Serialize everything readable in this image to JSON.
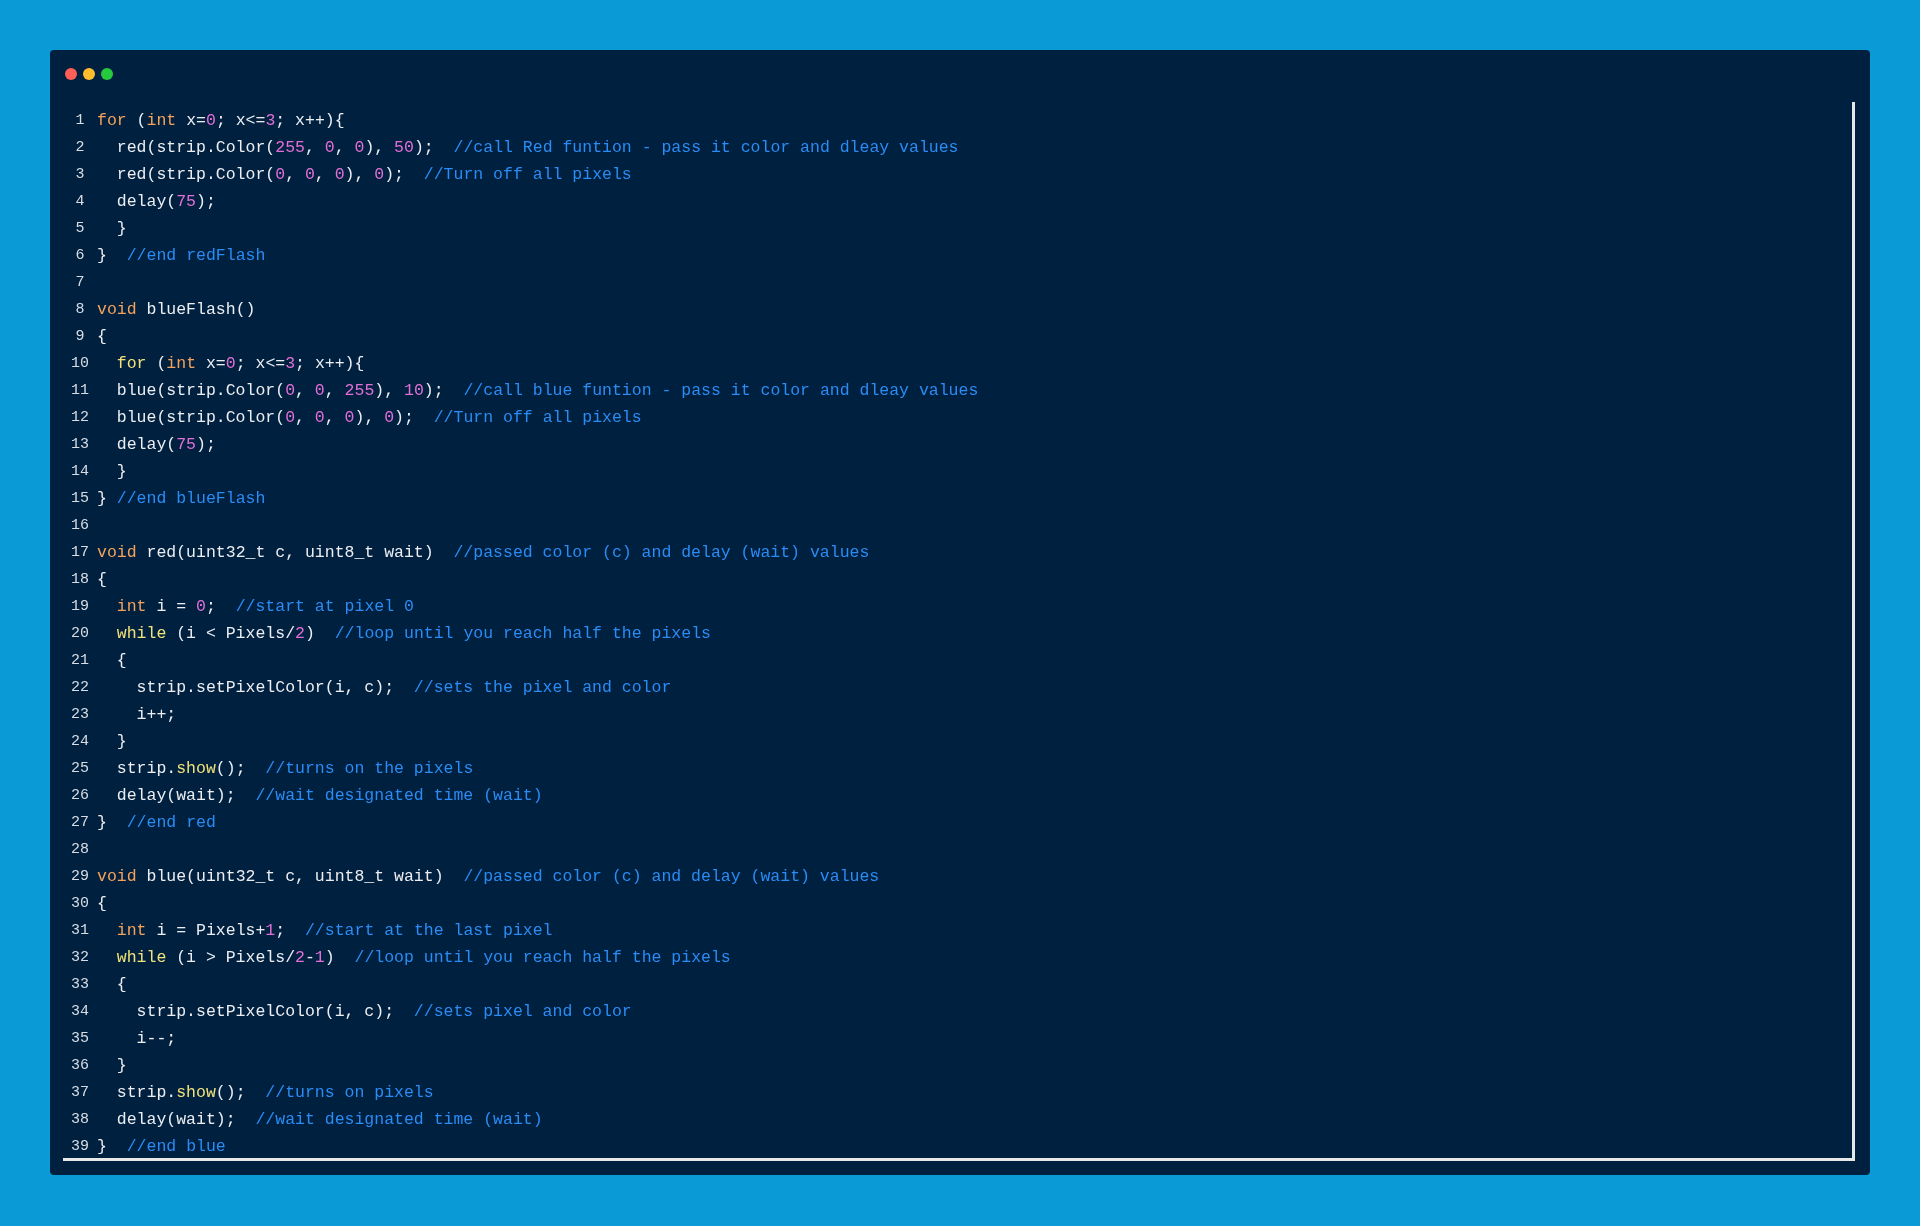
{
  "editor": {
    "lines": [
      {
        "number": "1",
        "tokens": [
          {
            "kind": "kw",
            "text": "for"
          },
          {
            "kind": "txt",
            "text": " ("
          },
          {
            "kind": "kw",
            "text": "int"
          },
          {
            "kind": "txt",
            "text": " x="
          },
          {
            "kind": "num",
            "text": "0"
          },
          {
            "kind": "txt",
            "text": "; x<="
          },
          {
            "kind": "num",
            "text": "3"
          },
          {
            "kind": "txt",
            "text": "; x++){"
          }
        ]
      },
      {
        "number": "2",
        "tokens": [
          {
            "kind": "txt",
            "text": "  red(strip.Color("
          },
          {
            "kind": "num",
            "text": "255"
          },
          {
            "kind": "txt",
            "text": ", "
          },
          {
            "kind": "num",
            "text": "0"
          },
          {
            "kind": "txt",
            "text": ", "
          },
          {
            "kind": "num",
            "text": "0"
          },
          {
            "kind": "txt",
            "text": "), "
          },
          {
            "kind": "num",
            "text": "50"
          },
          {
            "kind": "txt",
            "text": ");  "
          },
          {
            "kind": "cmt",
            "text": "//call Red funtion - pass it color and dleay values"
          }
        ]
      },
      {
        "number": "3",
        "tokens": [
          {
            "kind": "txt",
            "text": "  red(strip.Color("
          },
          {
            "kind": "num",
            "text": "0"
          },
          {
            "kind": "txt",
            "text": ", "
          },
          {
            "kind": "num",
            "text": "0"
          },
          {
            "kind": "txt",
            "text": ", "
          },
          {
            "kind": "num",
            "text": "0"
          },
          {
            "kind": "txt",
            "text": "), "
          },
          {
            "kind": "num",
            "text": "0"
          },
          {
            "kind": "txt",
            "text": ");  "
          },
          {
            "kind": "cmt",
            "text": "//Turn off all pixels"
          }
        ]
      },
      {
        "number": "4",
        "tokens": [
          {
            "kind": "txt",
            "text": "  delay("
          },
          {
            "kind": "num",
            "text": "75"
          },
          {
            "kind": "txt",
            "text": ");"
          }
        ]
      },
      {
        "number": "5",
        "tokens": [
          {
            "kind": "txt",
            "text": "  }"
          }
        ]
      },
      {
        "number": "6",
        "tokens": [
          {
            "kind": "txt",
            "text": "}  "
          },
          {
            "kind": "cmt",
            "text": "//end redFlash"
          }
        ]
      },
      {
        "number": "7"
      },
      {
        "number": "8",
        "tokens": [
          {
            "kind": "kw",
            "text": "void"
          },
          {
            "kind": "txt",
            "text": " blueFlash()"
          }
        ]
      },
      {
        "number": "9",
        "tokens": [
          {
            "kind": "txt",
            "text": "{"
          }
        ]
      },
      {
        "number": "10",
        "tokens": [
          {
            "kind": "ctl",
            "text": "  for"
          },
          {
            "kind": "txt",
            "text": " ("
          },
          {
            "kind": "kw",
            "text": "int"
          },
          {
            "kind": "txt",
            "text": " x="
          },
          {
            "kind": "num",
            "text": "0"
          },
          {
            "kind": "txt",
            "text": "; x<="
          },
          {
            "kind": "num",
            "text": "3"
          },
          {
            "kind": "txt",
            "text": "; x++){"
          }
        ]
      },
      {
        "number": "11",
        "tokens": [
          {
            "kind": "txt",
            "text": "  blue(strip.Color("
          },
          {
            "kind": "num",
            "text": "0"
          },
          {
            "kind": "txt",
            "text": ", "
          },
          {
            "kind": "num",
            "text": "0"
          },
          {
            "kind": "txt",
            "text": ", "
          },
          {
            "kind": "num",
            "text": "255"
          },
          {
            "kind": "txt",
            "text": "), "
          },
          {
            "kind": "num",
            "text": "10"
          },
          {
            "kind": "txt",
            "text": ");  "
          },
          {
            "kind": "cmt",
            "text": "//call blue funtion - pass it color and dleay values"
          }
        ]
      },
      {
        "number": "12",
        "tokens": [
          {
            "kind": "txt",
            "text": "  blue(strip.Color("
          },
          {
            "kind": "num",
            "text": "0"
          },
          {
            "kind": "txt",
            "text": ", "
          },
          {
            "kind": "num",
            "text": "0"
          },
          {
            "kind": "txt",
            "text": ", "
          },
          {
            "kind": "num",
            "text": "0"
          },
          {
            "kind": "txt",
            "text": "), "
          },
          {
            "kind": "num",
            "text": "0"
          },
          {
            "kind": "txt",
            "text": ");  "
          },
          {
            "kind": "cmt",
            "text": "//Turn off all pixels"
          }
        ]
      },
      {
        "number": "13",
        "tokens": [
          {
            "kind": "txt",
            "text": "  delay("
          },
          {
            "kind": "num",
            "text": "75"
          },
          {
            "kind": "txt",
            "text": ");"
          }
        ]
      },
      {
        "number": "14",
        "tokens": [
          {
            "kind": "txt",
            "text": "  }"
          }
        ]
      },
      {
        "number": "15",
        "tokens": [
          {
            "kind": "txt",
            "text": "} "
          },
          {
            "kind": "cmt",
            "text": "//end blueFlash"
          }
        ]
      },
      {
        "number": "16"
      },
      {
        "number": "17",
        "tokens": [
          {
            "kind": "kw",
            "text": "void"
          },
          {
            "kind": "txt",
            "text": " red(uint32_t c, uint8_t wait)  "
          },
          {
            "kind": "cmt",
            "text": "//passed color (c) and delay (wait) values"
          }
        ]
      },
      {
        "number": "18",
        "tokens": [
          {
            "kind": "txt",
            "text": "{"
          }
        ]
      },
      {
        "number": "19",
        "tokens": [
          {
            "kind": "kw",
            "text": "  int"
          },
          {
            "kind": "txt",
            "text": " i = "
          },
          {
            "kind": "num",
            "text": "0"
          },
          {
            "kind": "txt",
            "text": ";  "
          },
          {
            "kind": "cmt",
            "text": "//start at pixel 0"
          }
        ]
      },
      {
        "number": "20",
        "tokens": [
          {
            "kind": "ctl",
            "text": "  while"
          },
          {
            "kind": "txt",
            "text": " (i < Pixels/"
          },
          {
            "kind": "num",
            "text": "2"
          },
          {
            "kind": "txt",
            "text": ")  "
          },
          {
            "kind": "cmt",
            "text": "//loop until you reach half the pixels"
          }
        ]
      },
      {
        "number": "21",
        "tokens": [
          {
            "kind": "txt",
            "text": "  {"
          }
        ]
      },
      {
        "number": "22",
        "tokens": [
          {
            "kind": "txt",
            "text": "    strip.setPixelColor(i, c);  "
          },
          {
            "kind": "cmt",
            "text": "//sets the pixel and color"
          }
        ]
      },
      {
        "number": "23",
        "tokens": [
          {
            "kind": "txt",
            "text": "    i++;"
          }
        ]
      },
      {
        "number": "24",
        "tokens": [
          {
            "kind": "txt",
            "text": "  }"
          }
        ]
      },
      {
        "number": "25",
        "tokens": [
          {
            "kind": "txt",
            "text": "  strip."
          },
          {
            "kind": "fn",
            "text": "show"
          },
          {
            "kind": "txt",
            "text": "();  "
          },
          {
            "kind": "cmt",
            "text": "//turns on the pixels"
          }
        ]
      },
      {
        "number": "26",
        "tokens": [
          {
            "kind": "txt",
            "text": "  delay(wait);  "
          },
          {
            "kind": "cmt",
            "text": "//wait designated time (wait)"
          }
        ]
      },
      {
        "number": "27",
        "tokens": [
          {
            "kind": "txt",
            "text": "}  "
          },
          {
            "kind": "cmt",
            "text": "//end red"
          }
        ]
      },
      {
        "number": "28"
      },
      {
        "number": "29",
        "tokens": [
          {
            "kind": "kw",
            "text": "void"
          },
          {
            "kind": "txt",
            "text": " blue(uint32_t c, uint8_t wait)  "
          },
          {
            "kind": "cmt",
            "text": "//passed color (c) and delay (wait) values"
          }
        ]
      },
      {
        "number": "30",
        "tokens": [
          {
            "kind": "txt",
            "text": "{"
          }
        ]
      },
      {
        "number": "31",
        "tokens": [
          {
            "kind": "kw",
            "text": "  int"
          },
          {
            "kind": "txt",
            "text": " i = Pixels+"
          },
          {
            "kind": "num",
            "text": "1"
          },
          {
            "kind": "txt",
            "text": ";  "
          },
          {
            "kind": "cmt",
            "text": "//start at the last pixel"
          }
        ]
      },
      {
        "number": "32",
        "tokens": [
          {
            "kind": "ctl",
            "text": "  while"
          },
          {
            "kind": "txt",
            "text": " (i > Pixels/"
          },
          {
            "kind": "num",
            "text": "2"
          },
          {
            "kind": "txt",
            "text": "-"
          },
          {
            "kind": "num",
            "text": "1"
          },
          {
            "kind": "txt",
            "text": ")  "
          },
          {
            "kind": "cmt",
            "text": "//loop until you reach half the pixels"
          }
        ]
      },
      {
        "number": "33",
        "tokens": [
          {
            "kind": "txt",
            "text": "  {"
          }
        ]
      },
      {
        "number": "34",
        "tokens": [
          {
            "kind": "txt",
            "text": "    strip.setPixelColor(i, c);  "
          },
          {
            "kind": "cmt",
            "text": "//sets pixel and color"
          }
        ]
      },
      {
        "number": "35",
        "tokens": [
          {
            "kind": "txt",
            "text": "    i--;"
          }
        ]
      },
      {
        "number": "36",
        "tokens": [
          {
            "kind": "txt",
            "text": "  }"
          }
        ]
      },
      {
        "number": "37",
        "tokens": [
          {
            "kind": "txt",
            "text": "  strip."
          },
          {
            "kind": "fn",
            "text": "show"
          },
          {
            "kind": "txt",
            "text": "();  "
          },
          {
            "kind": "cmt",
            "text": "//turns on pixels"
          }
        ]
      },
      {
        "number": "38",
        "tokens": [
          {
            "kind": "txt",
            "text": "  delay(wait);  "
          },
          {
            "kind": "cmt",
            "text": "//wait designated time (wait)"
          }
        ]
      },
      {
        "number": "39",
        "tokens": [
          {
            "kind": "txt",
            "text": "}  "
          },
          {
            "kind": "cmt",
            "text": "//end blue"
          }
        ]
      }
    ]
  }
}
